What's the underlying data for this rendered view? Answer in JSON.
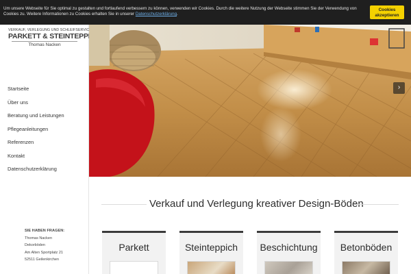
{
  "cookie": {
    "text": "Um unsere Webseite für Sie optimal zu gestalten und fortlaufend verbessern zu können, verwenden wir Cookies. Durch die weitere Nutzung der Webseite stimmen Sie der Verwendung von Cookies zu. Weitere Informationen zu Cookies erhalten Sie in unserer ",
    "link": "Datenschutzerklärung",
    "suffix": ".",
    "accept_line1": "Cookies",
    "accept_line2": "akzeptieren"
  },
  "logo": {
    "top": "VERKAUF, VERLEGUNG UND SCHLEIFSERVICE VON",
    "main": "PARKETT & STEINTEPPICH",
    "sub": "Thomas Nacken"
  },
  "nav": {
    "items": [
      "Startseite",
      "Über uns",
      "Beratung und Leistungen",
      "Pflegeanleitungen",
      "Referenzen",
      "Kontakt",
      "Datenschutzerklärung"
    ]
  },
  "contact": {
    "heading": "SIE HABEN FRAGEN:",
    "name": "Thomas Nacken",
    "company": "Dekorböden",
    "street": "Am Alten Sportplatz 21",
    "city": "52511 Geilenkirchen"
  },
  "hero": {
    "next_arrow": "›"
  },
  "main": {
    "headline": "Verkauf und Verlegung kreativer Design-Böden"
  },
  "cards": [
    {
      "title": "Parkett"
    },
    {
      "title": "Steinteppich"
    },
    {
      "title": "Beschichtung"
    },
    {
      "title": "Betonböden"
    }
  ]
}
